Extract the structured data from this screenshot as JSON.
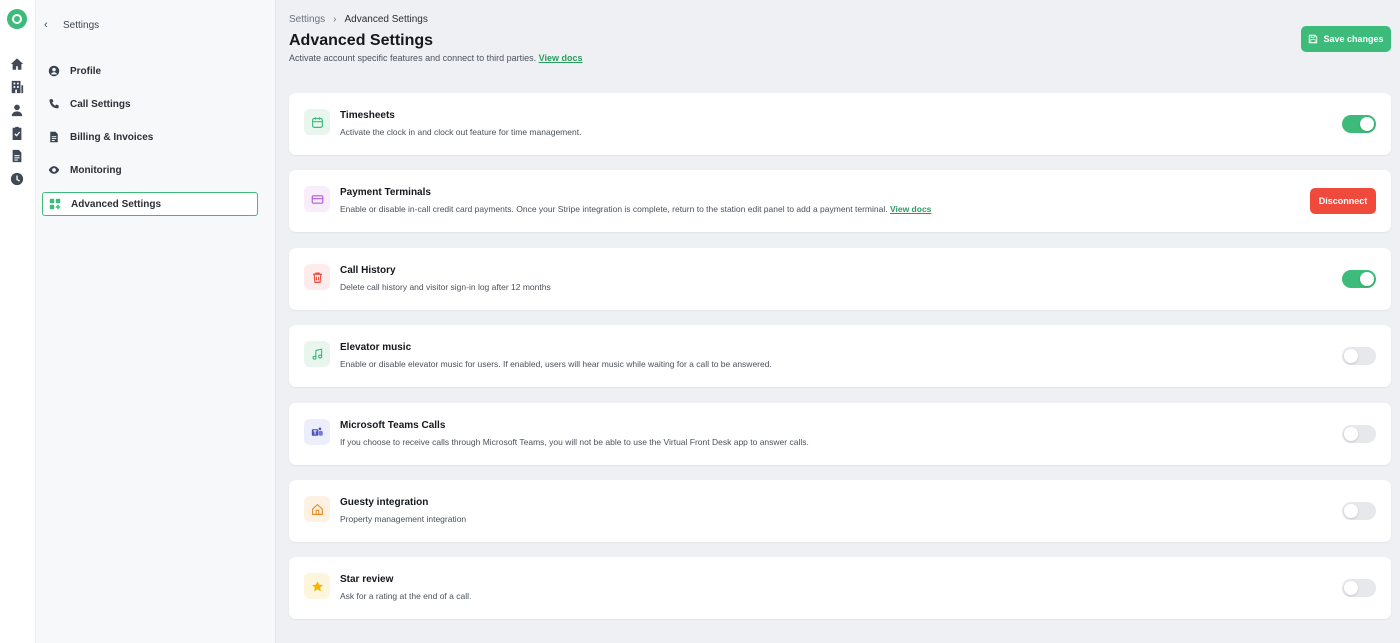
{
  "app": {
    "accent": "#3dbb7a",
    "danger": "#ef4a3c",
    "rail_icons": [
      "home-icon",
      "building-icon",
      "person-icon",
      "clipboard-check-icon",
      "document-icon",
      "clock-icon"
    ]
  },
  "sidebar": {
    "back_label": "Settings",
    "items": [
      {
        "label": "Profile",
        "icon": "user-circle-icon",
        "active": false
      },
      {
        "label": "Call Settings",
        "icon": "phone-icon",
        "active": false
      },
      {
        "label": "Billing & Invoices",
        "icon": "receipt-icon",
        "active": false
      },
      {
        "label": "Monitoring",
        "icon": "eye-icon",
        "active": false
      },
      {
        "label": "Advanced Settings",
        "icon": "grid-plus-icon",
        "active": true
      }
    ]
  },
  "header": {
    "breadcrumb": [
      "Settings",
      "Advanced Settings"
    ],
    "title": "Advanced Settings",
    "subtitle": "Activate account specific features and connect to third parties.",
    "docs_link": "View docs",
    "save_label": "Save changes"
  },
  "settings": [
    {
      "title": "Timesheets",
      "desc": "Activate the clock in and clock out feature for time management.",
      "control": "toggle",
      "enabled": true,
      "icon": "calendar-icon",
      "icon_color": "#3dbb7a",
      "icon_bg": "#e8f6ee"
    },
    {
      "title": "Payment Terminals",
      "desc": "Enable or disable in-call credit card payments. Once your Stripe integration is complete, return to the station edit panel to add a payment terminal.",
      "link": "View docs",
      "control": "button",
      "button_label": "Disconnect",
      "icon": "credit-card-icon",
      "icon_color": "#b65ad6",
      "icon_bg": "#f7edfb"
    },
    {
      "title": "Call History",
      "desc": "Delete call history and visitor sign-in log after 12 months",
      "control": "toggle",
      "enabled": true,
      "icon": "trash-icon",
      "icon_color": "#ef4a3c",
      "icon_bg": "#fdeceb"
    },
    {
      "title": "Elevator music",
      "desc": "Enable or disable elevator music for users. If enabled, users will hear music while waiting for a call to be answered.",
      "control": "toggle",
      "enabled": false,
      "icon": "music-note-icon",
      "icon_color": "#3dbb7a",
      "icon_bg": "#e8f6ee"
    },
    {
      "title": "Microsoft Teams Calls",
      "desc": "If you choose to receive calls through Microsoft Teams, you will not be able to use the Virtual Front Desk app to answer calls.",
      "control": "toggle",
      "enabled": false,
      "icon": "teams-icon",
      "icon_color": "#4b53bc",
      "icon_bg": "#eceefb"
    },
    {
      "title": "Guesty integration",
      "desc": "Property management integration",
      "control": "toggle",
      "enabled": false,
      "icon": "house-icon",
      "icon_color": "#f08a24",
      "icon_bg": "#fdf1e4"
    },
    {
      "title": "Star review",
      "desc": "Ask for a rating at the end of a call.",
      "control": "toggle",
      "enabled": false,
      "icon": "star-icon",
      "icon_color": "#f5b400",
      "icon_bg": "#fdf6dc"
    }
  ]
}
